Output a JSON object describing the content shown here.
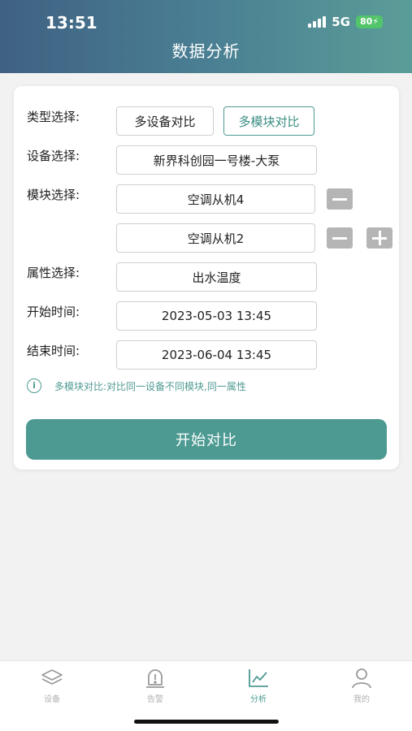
{
  "status": {
    "time": "13:51",
    "network": "5G",
    "battery": "80"
  },
  "header": {
    "title": "数据分析"
  },
  "form": {
    "type_label": "类型选择:",
    "type_options": [
      "多设备对比",
      "多模块对比"
    ],
    "device_label": "设备选择:",
    "device_value": "新界科创园一号楼-大泵",
    "module_label": "模块选择:",
    "modules": [
      "空调从机4",
      "空调从机2"
    ],
    "attribute_label": "属性选择:",
    "attribute_value": "出水温度",
    "start_label": "开始时间:",
    "start_value": "2023-05-03 13:45",
    "end_label": "结束时间:",
    "end_value": "2023-06-04 13:45",
    "tip": "多模块对比:对比同一设备不同模块,同一属性",
    "submit_label": "开始对比"
  },
  "tabs": [
    {
      "label": "设备",
      "icon": "layers-icon"
    },
    {
      "label": "告警",
      "icon": "alarm-icon"
    },
    {
      "label": "分析",
      "icon": "chart-line-icon",
      "active": true
    },
    {
      "label": "我的",
      "icon": "user-icon"
    }
  ],
  "colors": {
    "accent": "#4d9a92",
    "header_start": "#3f6183",
    "header_end": "#5b9d98"
  }
}
